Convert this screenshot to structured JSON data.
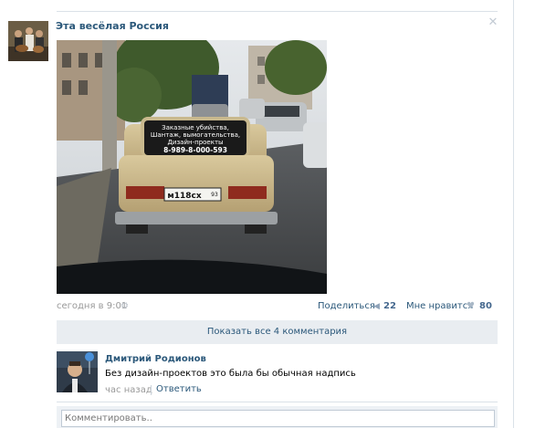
{
  "post": {
    "group_name": "Эта весёлая Россия",
    "date": "сегодня в 9:01",
    "share_label": "Поделиться",
    "share_count": "22",
    "like_label": "Мне нравится",
    "like_count": "80",
    "photo_text": {
      "line1": "Заказные убийства,",
      "line2": "Шантаж, вымогательства,",
      "line3": "Дизайн-проекты",
      "phone": "8-989-8-000-593",
      "plate": "м118сх",
      "plate_region": "93"
    }
  },
  "comments": {
    "show_all_label": "Показать все 4 комментария",
    "items": [
      {
        "author": "Дмитрий Родионов",
        "text": "Без дизайн-проектов это была бы обычная надпись",
        "time": "час назад",
        "reply_label": "Ответить"
      }
    ],
    "input_placeholder": "Комментировать.."
  },
  "icons": {
    "close": "close-icon",
    "gear": "gear-icon",
    "share": "megaphone-icon",
    "like": "heart-icon"
  },
  "colors": {
    "link": "#2b587a",
    "meta": "#999999",
    "panel": "#e9edf1"
  }
}
